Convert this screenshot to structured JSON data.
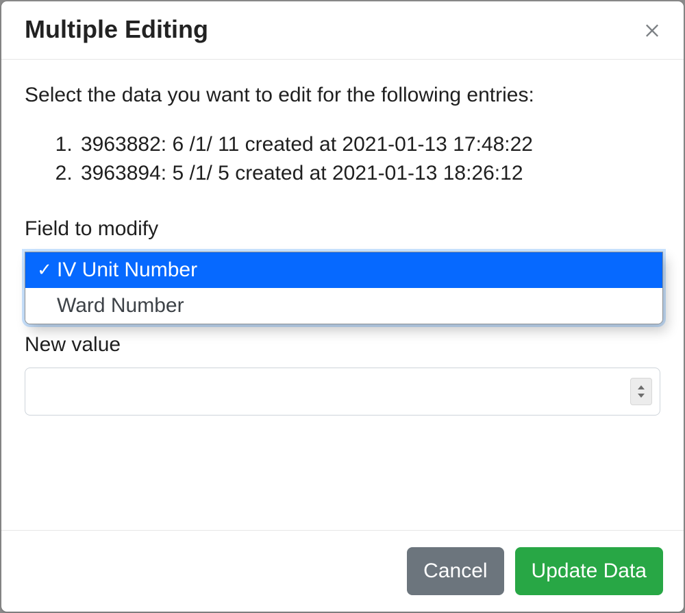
{
  "header": {
    "title": "Multiple Editing"
  },
  "body": {
    "prompt": "Select the data you want to edit for the following entries:",
    "entries": [
      "3963882: 6 /1/ 11 created at 2021-01-13 17:48:22",
      "3963894: 5 /1/ 5 created at 2021-01-13 18:26:12"
    ],
    "field_label": "Field to modify",
    "field_options": [
      {
        "label": "IV Unit Number",
        "selected": true
      },
      {
        "label": "Ward Number",
        "selected": false
      }
    ],
    "new_value_label": "New value",
    "new_value": ""
  },
  "footer": {
    "cancel_label": "Cancel",
    "confirm_label": "Update Data"
  }
}
